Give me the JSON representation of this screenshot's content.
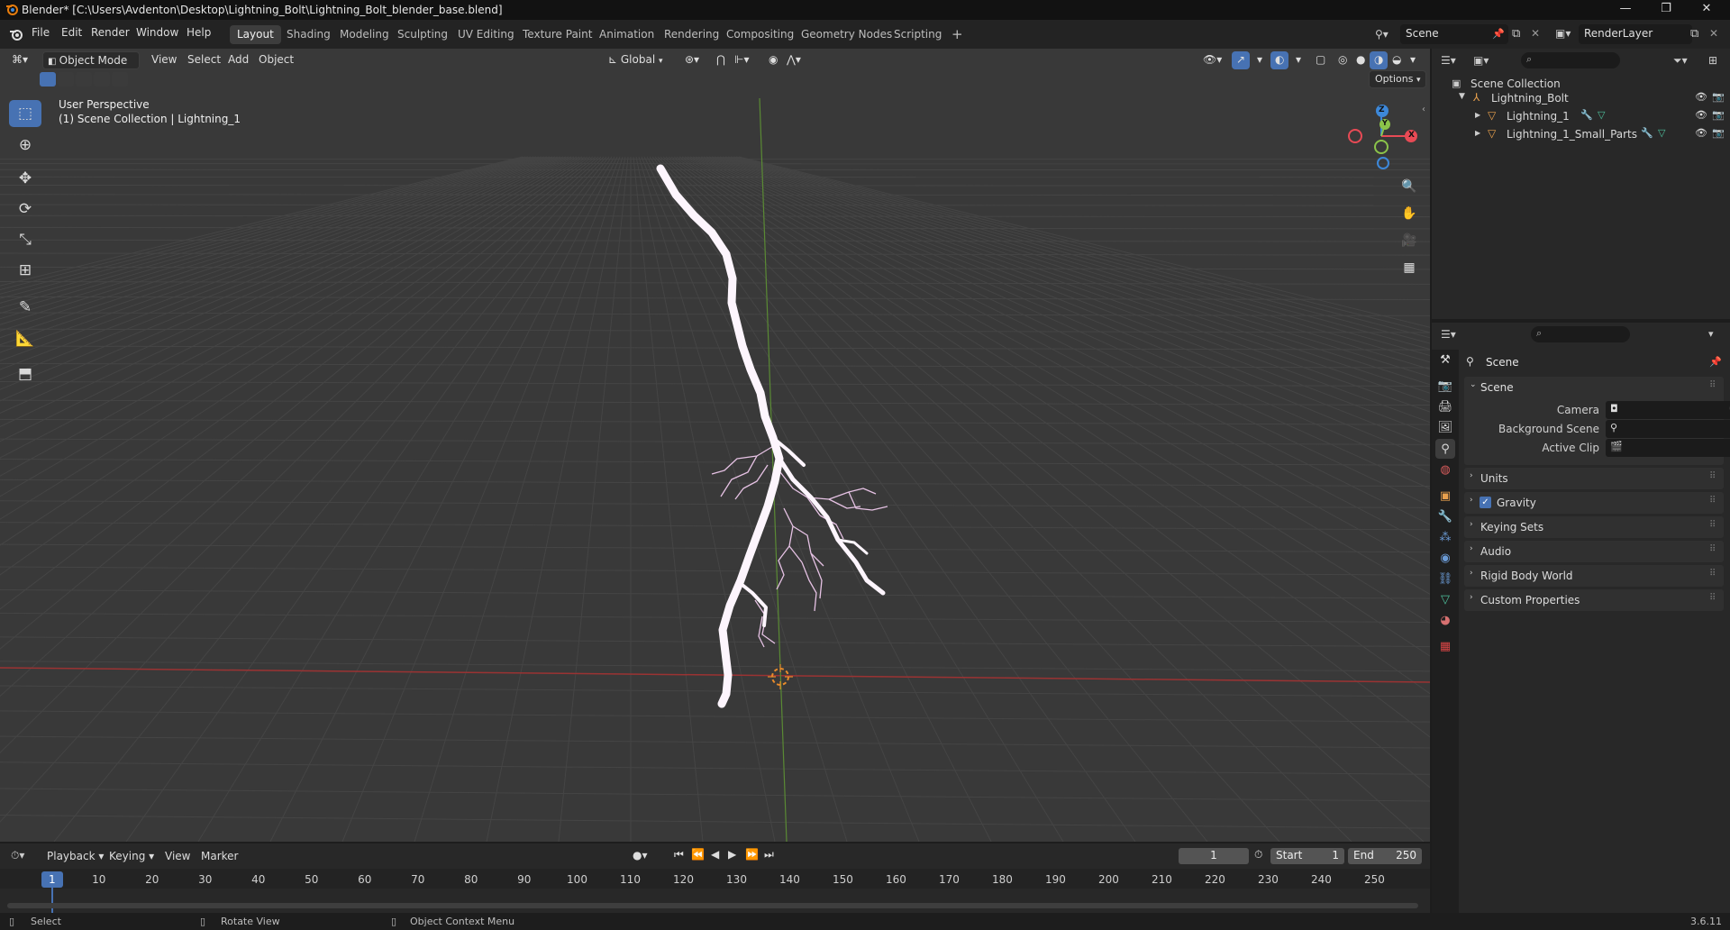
{
  "window": {
    "title": "Blender* [C:\\Users\\Avdenton\\Desktop\\Lightning_Bolt\\Lightning_Bolt_blender_base.blend]",
    "minimize_glyph": "—",
    "maximize_glyph": "❐",
    "close_glyph": "✕"
  },
  "menu": {
    "items": [
      "File",
      "Edit",
      "Render",
      "Window",
      "Help"
    ]
  },
  "workspaces": {
    "tabs": [
      "Layout",
      "Shading",
      "Modeling",
      "Sculpting",
      "UV Editing",
      "Texture Paint",
      "Animation",
      "Rendering",
      "Compositing",
      "Geometry Nodes",
      "Scripting"
    ],
    "active": "Layout",
    "add_glyph": "+"
  },
  "scene_selector": {
    "value": "Scene"
  },
  "renderlayer_selector": {
    "value": "RenderLayer"
  },
  "viewport": {
    "mode": "Object Mode",
    "menus": [
      "View",
      "Select",
      "Add",
      "Object"
    ],
    "orientation": "Global",
    "options_label": "Options",
    "perspective_label": "User Perspective",
    "collection_label": "(1) Scene Collection | Lightning_1",
    "gizmo": {
      "x": "X",
      "y": "Y",
      "z": "Z"
    }
  },
  "outliner": {
    "root": "Scene Collection",
    "collection": "Lightning_Bolt",
    "objects": [
      "Lightning_1",
      "Lightning_1_Small_Parts"
    ]
  },
  "properties": {
    "context_title": "Scene",
    "section": "Scene",
    "fields": [
      {
        "label": "Camera",
        "value": ""
      },
      {
        "label": "Background Scene",
        "value": ""
      },
      {
        "label": "Active Clip",
        "value": ""
      }
    ],
    "panels": [
      "Units",
      "Gravity",
      "Keying Sets",
      "Audio",
      "Rigid Body World",
      "Custom Properties"
    ],
    "gravity_checked": true
  },
  "timeline": {
    "menus": [
      "Playback",
      "Keying",
      "View",
      "Marker"
    ],
    "current_frame": "1",
    "start_label": "Start",
    "start": "1",
    "end_label": "End",
    "end": "250",
    "ruler": [
      "1",
      "10",
      "20",
      "30",
      "40",
      "50",
      "60",
      "70",
      "80",
      "90",
      "100",
      "110",
      "120",
      "130",
      "140",
      "150",
      "160",
      "170",
      "180",
      "190",
      "200",
      "210",
      "220",
      "230",
      "240",
      "250"
    ]
  },
  "statusbar": {
    "select": "Select",
    "rotate": "Rotate View",
    "context_menu": "Object Context Menu",
    "version": "3.6.11"
  },
  "colors": {
    "accent": "#4772b3",
    "x_axis": "#d13f3f",
    "y_axis": "#5f9c3a",
    "bolt": "#fdf5fd",
    "bolt_branch": "#e6c2e4",
    "gizmo_x": "#e84a55",
    "gizmo_y": "#8bc34a",
    "gizmo_z": "#3d88d9"
  }
}
